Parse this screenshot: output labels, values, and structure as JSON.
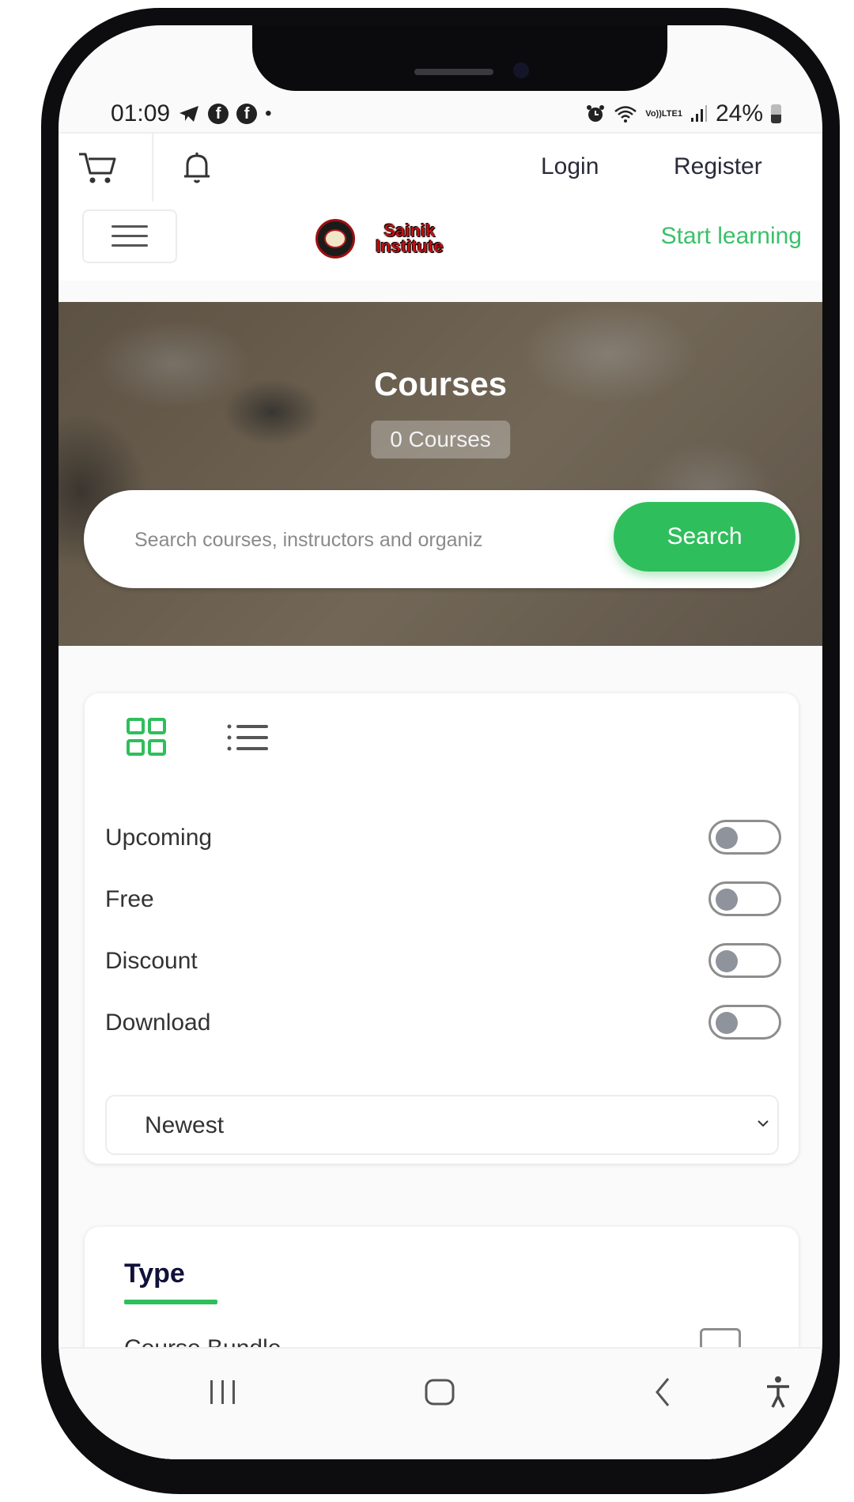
{
  "status_bar": {
    "time": "01:09",
    "left_icons": [
      "telegram-icon",
      "facebook-icon",
      "facebook-icon",
      "dot-icon"
    ],
    "right_icons": [
      "alarm-icon",
      "wifi-icon",
      "volte-lte-icon",
      "signal-icon"
    ],
    "lte_line1": "Vo))",
    "lte_line2": "LTE1",
    "battery": "24%"
  },
  "topbar": {
    "cart_icon": "cart-icon",
    "bell_icon": "bell-icon",
    "login_label": "Login",
    "register_label": "Register"
  },
  "navrow": {
    "menu_icon": "hamburger-menu-icon",
    "logo_line1": "Sainik",
    "logo_line2": "Institute",
    "start_learning_label": "Start learning"
  },
  "hero": {
    "title": "Courses",
    "count_badge": "0 Courses",
    "search_placeholder": "Search courses, instructors and organiz",
    "search_value": "",
    "search_button": "Search"
  },
  "filters": {
    "view_modes": [
      {
        "name": "grid-view",
        "active": true
      },
      {
        "name": "list-view",
        "active": false
      }
    ],
    "toggles": [
      {
        "label": "Upcoming",
        "on": false
      },
      {
        "label": "Free",
        "on": false
      },
      {
        "label": "Discount",
        "on": false
      },
      {
        "label": "Download",
        "on": false
      }
    ],
    "sort": {
      "selected": "Newest"
    }
  },
  "type_section": {
    "title": "Type",
    "options": [
      {
        "label": "Course Bundle",
        "checked": false
      }
    ]
  },
  "system_nav": {
    "buttons": [
      "recents",
      "home",
      "back",
      "accessibility"
    ]
  },
  "colors": {
    "accent_green": "#2fbe5c",
    "start_learning_green": "#3cc06a",
    "heading_navy": "#11113a"
  }
}
